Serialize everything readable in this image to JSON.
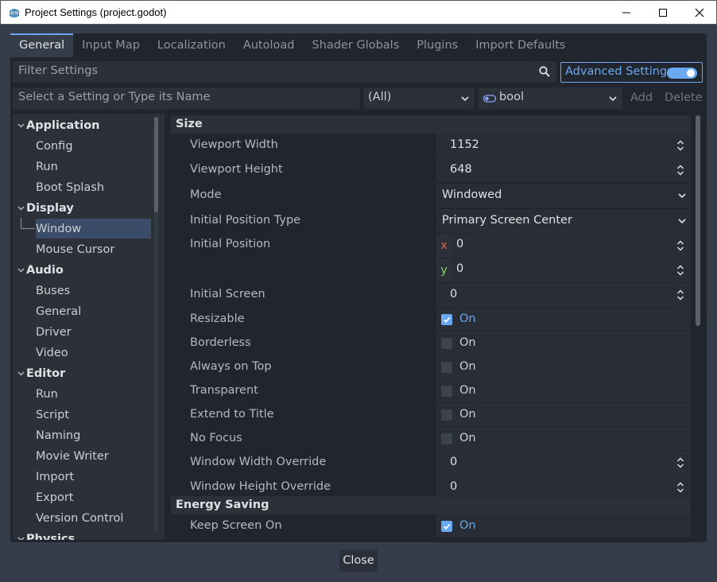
{
  "window": {
    "title": "Project Settings (project.godot)",
    "controls": [
      "minimize-icon",
      "maximize-icon",
      "close-icon"
    ]
  },
  "tabs": [
    "General",
    "Input Map",
    "Localization",
    "Autoload",
    "Shader Globals",
    "Plugins",
    "Import Defaults"
  ],
  "active_tab": "General",
  "filter": {
    "placeholder": "Filter Settings",
    "icon": "search-icon"
  },
  "advanced": {
    "label": "Advanced Settings",
    "enabled": true
  },
  "add_setting": {
    "placeholder": "Select a Setting or Type its Name",
    "scope": "(All)",
    "type": "bool",
    "add_label": "Add",
    "delete_label": "Delete"
  },
  "tree": [
    {
      "label": "Application",
      "section": true
    },
    {
      "label": "Config"
    },
    {
      "label": "Run"
    },
    {
      "label": "Boot Splash"
    },
    {
      "label": "Display",
      "section": true
    },
    {
      "label": "Window",
      "selected": true
    },
    {
      "label": "Mouse Cursor"
    },
    {
      "label": "Audio",
      "section": true
    },
    {
      "label": "Buses"
    },
    {
      "label": "General"
    },
    {
      "label": "Driver"
    },
    {
      "label": "Video"
    },
    {
      "label": "Editor",
      "section": true
    },
    {
      "label": "Run"
    },
    {
      "label": "Script"
    },
    {
      "label": "Naming"
    },
    {
      "label": "Movie Writer"
    },
    {
      "label": "Import"
    },
    {
      "label": "Export"
    },
    {
      "label": "Version Control"
    },
    {
      "label": "Physics",
      "section": true
    }
  ],
  "inspector": {
    "sections": [
      "Size",
      "Energy Saving"
    ],
    "properties": [
      {
        "label": "Viewport Width",
        "kind": "spin",
        "value": "1152"
      },
      {
        "label": "Viewport Height",
        "kind": "spin",
        "value": "648"
      },
      {
        "label": "Mode",
        "kind": "enum",
        "value": "Windowed"
      },
      {
        "label": "Initial Position Type",
        "kind": "enum",
        "value": "Primary Screen Center"
      },
      {
        "label": "Initial Position",
        "kind": "vector2",
        "x_label": "x",
        "x": "0",
        "y_label": "y",
        "y": "0"
      },
      {
        "label": "Initial Screen",
        "kind": "spin",
        "value": "0"
      },
      {
        "label": "Resizable",
        "kind": "bool",
        "checked": true,
        "text": "On"
      },
      {
        "label": "Borderless",
        "kind": "bool",
        "checked": false,
        "text": "On"
      },
      {
        "label": "Always on Top",
        "kind": "bool",
        "checked": false,
        "text": "On"
      },
      {
        "label": "Transparent",
        "kind": "bool",
        "checked": false,
        "text": "On"
      },
      {
        "label": "Extend to Title",
        "kind": "bool",
        "checked": false,
        "text": "On"
      },
      {
        "label": "No Focus",
        "kind": "bool",
        "checked": false,
        "text": "On"
      },
      {
        "label": "Window Width Override",
        "kind": "spin",
        "value": "0"
      },
      {
        "label": "Window Height Override",
        "kind": "spin",
        "value": "0"
      },
      {
        "label": "Keep Screen On",
        "kind": "bool",
        "checked": true,
        "text": "On"
      }
    ]
  },
  "footer": {
    "close_label": "Close"
  },
  "colors": {
    "accent": "#6aa9f2",
    "panel": "#21262e",
    "background": "#363d4a",
    "axis_x": "#e0634f",
    "axis_y": "#8fd16d"
  }
}
